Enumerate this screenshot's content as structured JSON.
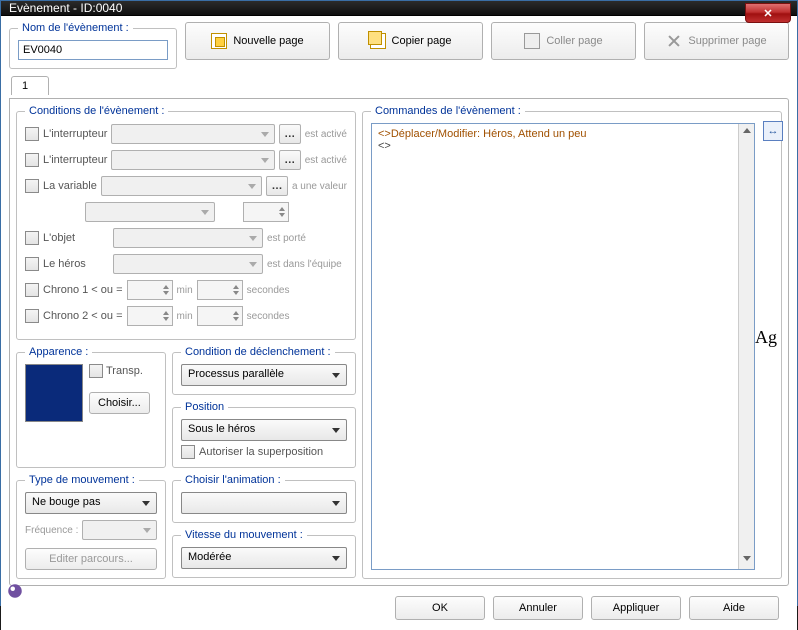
{
  "title": "Evènement - ID:0040",
  "name_group": "Nom de l'évènement :",
  "name_value": "EV0040",
  "buttons": {
    "new_page": "Nouvelle page",
    "copy_page": "Copier page",
    "paste_page": "Coller page",
    "delete_page": "Supprimer page"
  },
  "tab1": "1",
  "conditions": {
    "legend": "Conditions de l'évènement :",
    "switch1": "L'interrupteur",
    "switch1_suffix": "est activé",
    "switch2": "L'interrupteur",
    "switch2_suffix": "est activé",
    "variable": "La variable",
    "variable_suffix": "a une valeur",
    "item": "L'objet",
    "item_suffix": "est porté",
    "hero": "Le héros",
    "hero_suffix": "est dans l'équipe",
    "timer1": "Chrono 1 < ou =",
    "timer2": "Chrono 2 < ou =",
    "min": "min",
    "sec": "secondes"
  },
  "appearance": {
    "legend": "Apparence :",
    "transp": "Transp.",
    "choose": "Choisir..."
  },
  "move_type": {
    "legend": "Type de mouvement :",
    "value": "Ne bouge pas",
    "freq_label": "Fréquence :",
    "edit_route": "Editer parcours..."
  },
  "trigger": {
    "legend": "Condition de déclenchement :",
    "value": "Processus parallèle"
  },
  "position": {
    "legend": "Position",
    "value": "Sous le héros",
    "overlap": "Autoriser la superposition"
  },
  "animation": {
    "legend": "Choisir l'animation :",
    "value": ""
  },
  "speed": {
    "legend": "Vitesse du mouvement :",
    "value": "Modérée"
  },
  "commands": {
    "legend": "Commandes de l'évènement :",
    "line1": "<>Déplacer/Modifier: Héros, Attend un peu",
    "line2": "<>"
  },
  "side_label": "Ag",
  "footer": {
    "ok": "OK",
    "cancel": "Annuler",
    "apply": "Appliquer",
    "help": "Aide"
  }
}
